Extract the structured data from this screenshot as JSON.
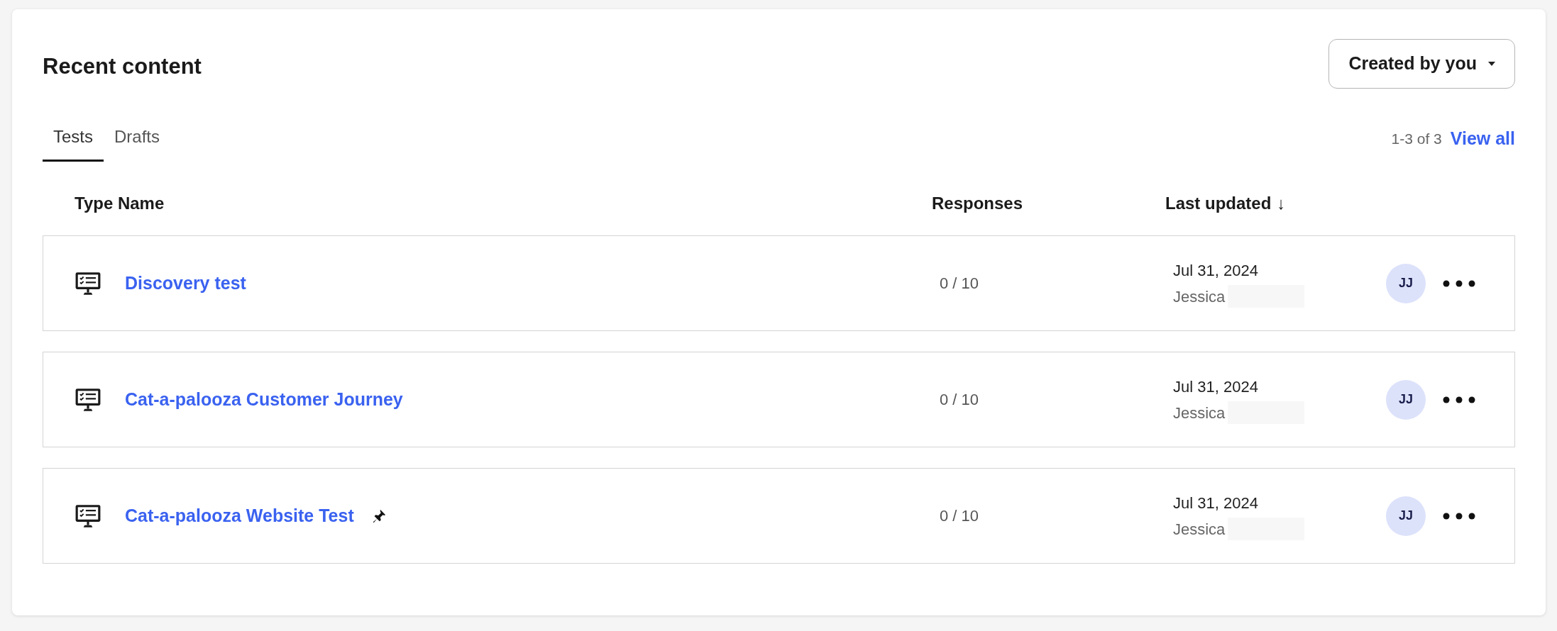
{
  "title": "Recent content",
  "filter": {
    "label": "Created by you"
  },
  "tabs": [
    {
      "label": "Tests",
      "selected": true
    },
    {
      "label": "Drafts",
      "selected": false
    }
  ],
  "pagination": {
    "range": "1-3 of 3",
    "link": "View all"
  },
  "table": {
    "columns": [
      "Type Name",
      "Responses",
      "Last updated"
    ],
    "sort_icon": "↓",
    "rows": [
      {
        "name": "Discovery test",
        "pinned": false,
        "responses": "0 / 10",
        "date": "Jul 31, 2024",
        "author": "Jessica",
        "avatar": "JJ"
      },
      {
        "name": "Cat-a-palooza Customer Journey",
        "pinned": false,
        "responses": "0 / 10",
        "date": "Jul 31, 2024",
        "author": "Jessica",
        "avatar": "JJ"
      },
      {
        "name": "Cat-a-palooza Website Test",
        "pinned": true,
        "responses": "0 / 10",
        "date": "Jul 31, 2024",
        "author": "Jessica",
        "avatar": "JJ"
      }
    ]
  }
}
